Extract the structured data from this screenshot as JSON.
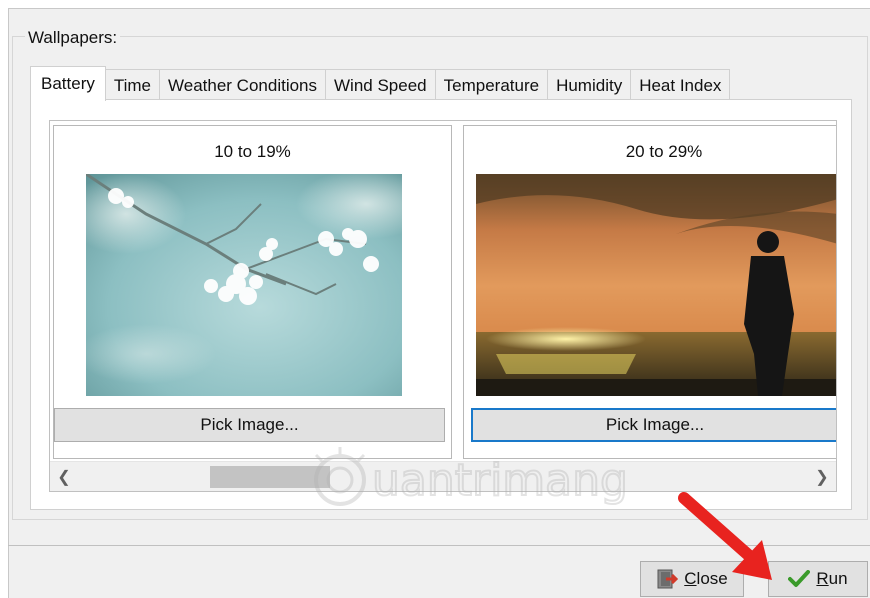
{
  "group": {
    "label": "Wallpapers:"
  },
  "tabs": [
    {
      "label": "Battery",
      "active": true
    },
    {
      "label": "Time",
      "active": false
    },
    {
      "label": "Weather Conditions",
      "active": false
    },
    {
      "label": "Wind Speed",
      "active": false
    },
    {
      "label": "Temperature",
      "active": false
    },
    {
      "label": "Humidity",
      "active": false
    },
    {
      "label": "Heat Index",
      "active": false
    }
  ],
  "cards": [
    {
      "range": "10 to 19%",
      "image": "cherry-blossom-photo",
      "button": "Pick Image..."
    },
    {
      "range": "20 to 29%",
      "image": "sunset-beach-photo",
      "button": "Pick Image..."
    }
  ],
  "scrollbar": {
    "left_icon": "chevron-left-icon",
    "right_icon": "chevron-right-icon"
  },
  "footer": {
    "close_label": "Close",
    "close_accel": "C",
    "close_rest": "lose",
    "run_label": "Run",
    "run_accel": "R",
    "run_rest": "un"
  },
  "watermark": "Quantrimang",
  "colors": {
    "focus": "#1979ca",
    "arrow": "#e8231f",
    "run_check": "#3a9a2a"
  }
}
